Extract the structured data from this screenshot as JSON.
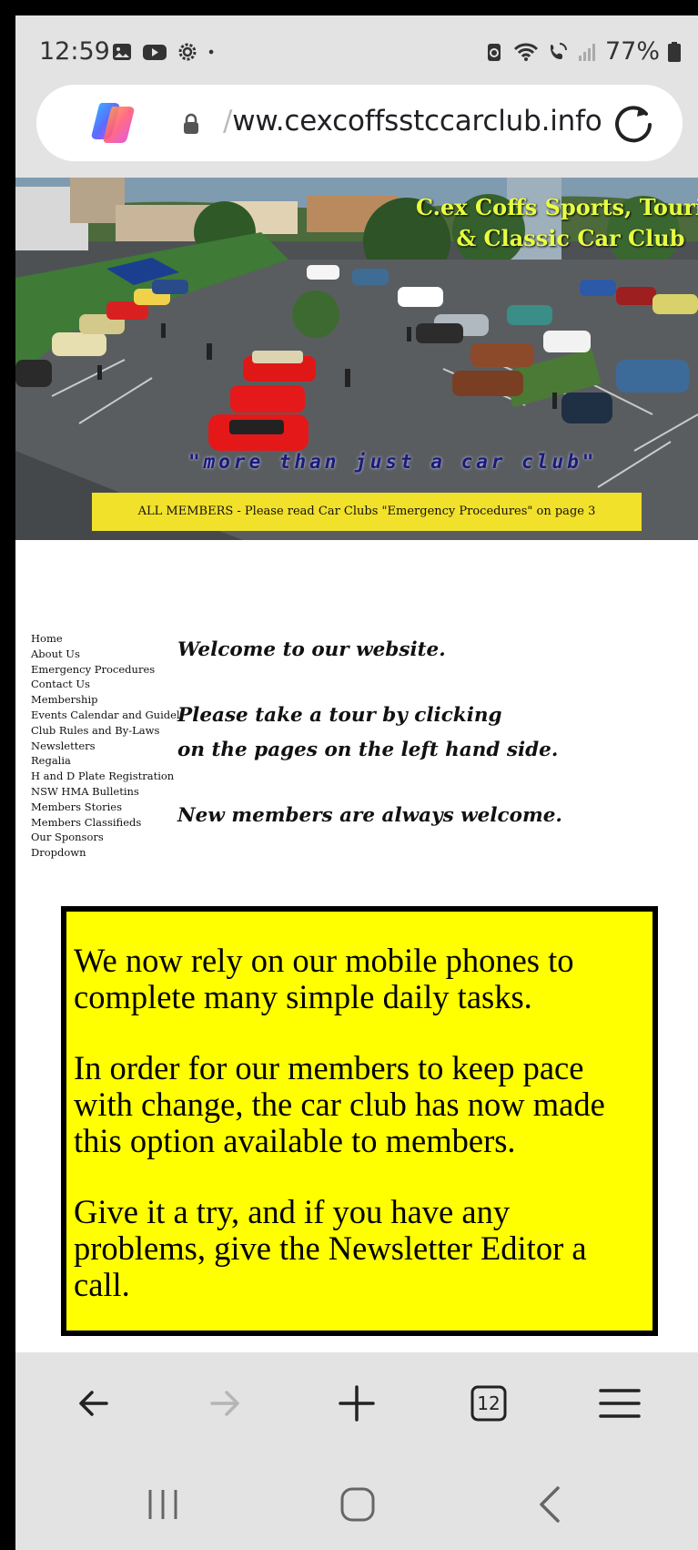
{
  "status_bar": {
    "time": "12:59",
    "battery": "77%"
  },
  "browser": {
    "url_faded": "/",
    "url": "ww.cexcoffsstccarclub.info",
    "tab_count": "12"
  },
  "hero": {
    "title_line1": "C.ex Coffs Sports, Touring",
    "title_line2": "& Classic Car Club",
    "slogan": "\"more than just a car club\"",
    "notice": "ALL MEMBERS - Please read Car Clubs \"Emergency Procedures\" on page 3"
  },
  "sidebar": {
    "items": [
      {
        "label": "Home"
      },
      {
        "label": "About Us"
      },
      {
        "label": "Emergency Procedures"
      },
      {
        "label": "Contact Us"
      },
      {
        "label": "Membership"
      },
      {
        "label": "Events Calendar and Guideli"
      },
      {
        "label": "Club Rules and By-Laws"
      },
      {
        "label": "Newsletters"
      },
      {
        "label": "Regalia"
      },
      {
        "label": "H and D Plate Registration"
      },
      {
        "label": "NSW HMA Bulletins"
      },
      {
        "label": "Members Stories"
      },
      {
        "label": "Members Classifieds"
      },
      {
        "label": "Our Sponsors"
      },
      {
        "label": "Dropdown"
      }
    ]
  },
  "welcome": {
    "line1": "Welcome to our website.",
    "line2": "Please take a tour by clicking",
    "line3": "on the pages on the left hand side.",
    "line4": "New members are always welcome."
  },
  "notice_box": {
    "para1": "We now rely on our mobile phones to complete many simple daily tasks.",
    "para2": "In order for our members to keep pace with change, the car club has now made this option available to members.",
    "para3": "Give it a try, and if you have any problems, give the Newsletter Editor a call."
  },
  "colors": {
    "hero_title": "#e8ff40",
    "notice_banner": "#f2e12a",
    "box_background": "#ffff00"
  }
}
